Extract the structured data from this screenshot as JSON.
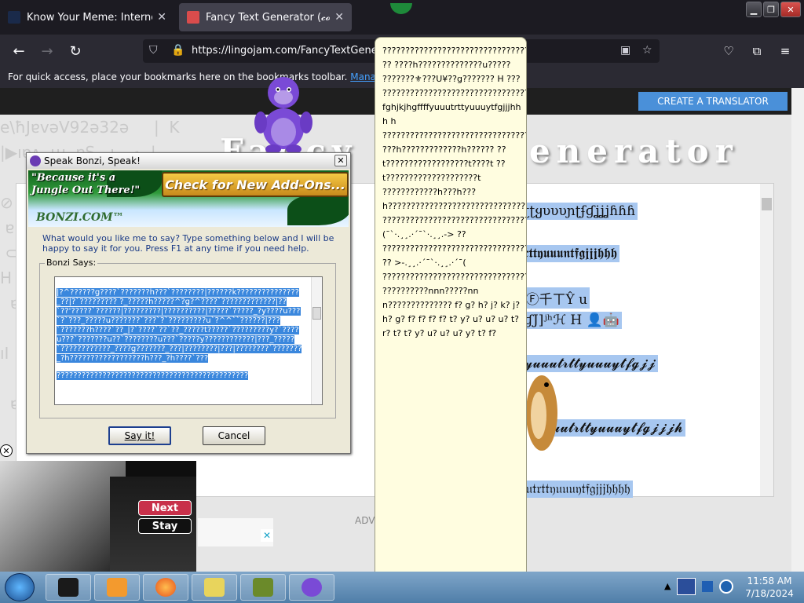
{
  "browser": {
    "tabs": [
      {
        "label": "Know Your Meme: Internet Memes",
        "favicon_color": "#1a2a4a"
      },
      {
        "label": "Fancy Text Generator (𝓬𝓸𝓹𝔂 𝓪𝓷𝓭 𝓹𝓪𝓼𝓽𝓮)",
        "favicon_color": "#d94c4c"
      }
    ],
    "url": "https://lingojam.com/FancyTextGenerator",
    "bookmarks_text": "For quick access, place your bookmarks here on the bookmarks toolbar.",
    "bookmarks_link": "Manage bookmarks…"
  },
  "site": {
    "create_button": "CREATE A TRANSLATOR",
    "title": "Fancy Text Generator",
    "background_glyphs": "e\\ħJɐvəV92ə32ə     |  K\n|▶ıɐʌ  ɯ  ɐS   ı    ₁  |    \n      ∂  ɐ   ₍₅        ⊕ɐɐ⊕ıƐ  \n⊘  ₁    ɯ   ı          ɐ   I  \n ɐ    ɐ    Ɛ    ı           \n ⊂       ₍  ₁   ɐ   ⊕     \nH   I   ı      ɐ        ₍  ı\n  ɐ  ₍     ı   ɐ       Ɐ    \n     ⊕   ı          ₍   \nıI       ɐ       ɯ   ıI   ₁  \n     ɐ   ı    ₍         ⊕ \n  ɐ   ı     H    ⊕   ı  ",
    "results": [
      "ʈɾʈʈყυυυɲʈʄɠʝʝʝɦɦɦ",
      "𝖚𝖙𝖗𝖙𝖙𝖞𝖚𝖚𝖚𝖓𝖙𝖋𝖌𝖏𝖏𝖏𝖍𝖍𝖍",
      "₣Ⓕ千ㄒŶ u",
      "ʄɠJ]ʲʰℋ H  👤🤖",
      "𝓯𝓽𝔂𝓾𝓾𝓾𝓽𝓻𝓽𝓽𝔂𝓾𝓾𝓾𝔂𝓽𝓯𝓰𝓳𝓳",
      "𝓾𝓾𝓽𝓻𝓽𝓽𝔂𝓾𝓾𝓾𝔂𝓽𝓯𝓰𝓳𝓳𝓳𝓱",
      "𝔲𝔲𝔲𝔱𝔯𝔱𝔱𝔶𝔲𝔲𝔲𝔶𝔱𝔣𝔤𝔧𝔧𝔧𝔥𝔥𝔥𝔥"
    ],
    "advert_label": "ADV"
  },
  "bonzi_dialog": {
    "title": "Speak Bonzi, Speak!",
    "close": "✕",
    "slogan_line1": "\"Because it's a",
    "slogan_line2": "Jungle Out There!\"",
    "addons_banner": "Check for New Add-Ons...",
    "brand": "BONZI.COM™",
    "prompt": "What would you like me to say? Type something below and I will be happy to say it for you. Press F1 at any time if you need help.",
    "group_label": "Bonzi Says:",
    "text_value": "|?^??????g????`???????h???`????????|??????k???????????????_??|?`????????? ?_?????h?????^?g?^????`?????????????|??`??'?????`??????|?????????|??????????|?????`?????_?y????u???`?`???_?????u???????`???`?`?????????u`?^^``??????|???`???????h????`??_|?`????`??`??_?????t?????`?????????y?`????u???`???????u??`????????u???`?????y????????????|???_?????`????????????_????g???????_???|????????|???|????????`???????_?h??????????????????h???_?h????`???",
    "text_tail": "??????????????????????????????????????????????",
    "say_button": "Say it!",
    "cancel_button": "Cancel"
  },
  "tooltip_text": "???????????????????????????????????????????????????????????????????????????????????????????????????????????????????????????????????????????????????????????????????????? ?? ????h??????????????u????? ???????⚜???U¥??g??????? H ??? ???????????????????????????????????????????????????????????????????????????????????????????????????????????????????????????????????????????????????????????????????????????????????????????????????????????????????????????? fghjkjhgffffyuuutrttyuuuytfgjjjhhh h ?????????????????????????????????? ???h?????????????h?????? ??t??????????????????t????t ??t????????????????????t ????????????h???h???h????????????????????????????????????????????? ????????????????????????????????????? (¯`·.¸¸.·´¯`·.¸¸.-> ?? ?????????????????????????????????????????????????????????????????????????????????? ?? >-.¸¸.·´¯`·.¸¸.·´¯( ?????????????????????????????????????? ??????????nnn?????nnn?????????????? f? g? h? j? k? j? h? g? f? f? f? f? t? y? u? u? u? t? r? t? t? y? u? u? u? y? t? f?",
  "video_popup": {
    "next": "Next",
    "stay": "Stay",
    "close": "✕"
  },
  "taskbar": {
    "time": "11:58 AM",
    "date": "7/18/2024"
  }
}
